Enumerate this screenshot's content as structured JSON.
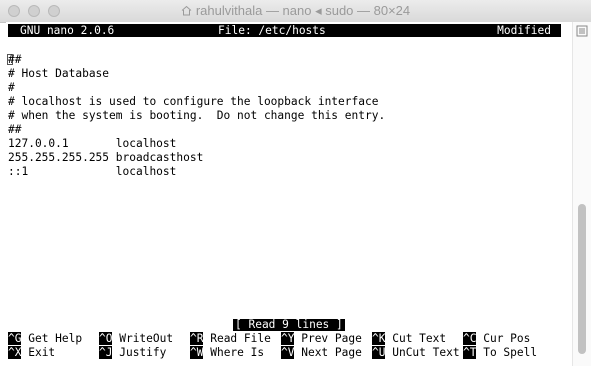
{
  "window": {
    "title": "rahulvithala — nano ◂ sudo — 80×24"
  },
  "nano": {
    "version": "GNU nano 2.0.6",
    "file_label": "File: /etc/hosts",
    "status": "Modified",
    "lines": [
      "##",
      "# Host Database",
      "#",
      "# localhost is used to configure the loopback interface",
      "# when the system is booting.  Do not change this entry.",
      "##",
      "127.0.0.1       localhost",
      "255.255.255.255 broadcasthost",
      "::1             localhost"
    ],
    "message": "[ Read 9 lines ]",
    "shortcuts_row1": [
      {
        "key": "^G",
        "label": " Get Help"
      },
      {
        "key": "^O",
        "label": " WriteOut"
      },
      {
        "key": "^R",
        "label": " Read File"
      },
      {
        "key": "^Y",
        "label": " Prev Page"
      },
      {
        "key": "^K",
        "label": " Cut Text"
      },
      {
        "key": "^C",
        "label": " Cur Pos"
      }
    ],
    "shortcuts_row2": [
      {
        "key": "^X",
        "label": " Exit"
      },
      {
        "key": "^J",
        "label": " Justify"
      },
      {
        "key": "^W",
        "label": " Where Is"
      },
      {
        "key": "^V",
        "label": " Next Page"
      },
      {
        "key": "^U",
        "label": " UnCut Text"
      },
      {
        "key": "^T",
        "label": " To Spell"
      }
    ]
  },
  "icons": {
    "title_icon": "home-icon",
    "scrollbar_menu": "menu-icon"
  },
  "colors": {
    "terminal_bg": "#ffffff",
    "inverse_bg": "#000000",
    "inverse_fg": "#ffffff",
    "title_text": "#9a9a9a"
  }
}
